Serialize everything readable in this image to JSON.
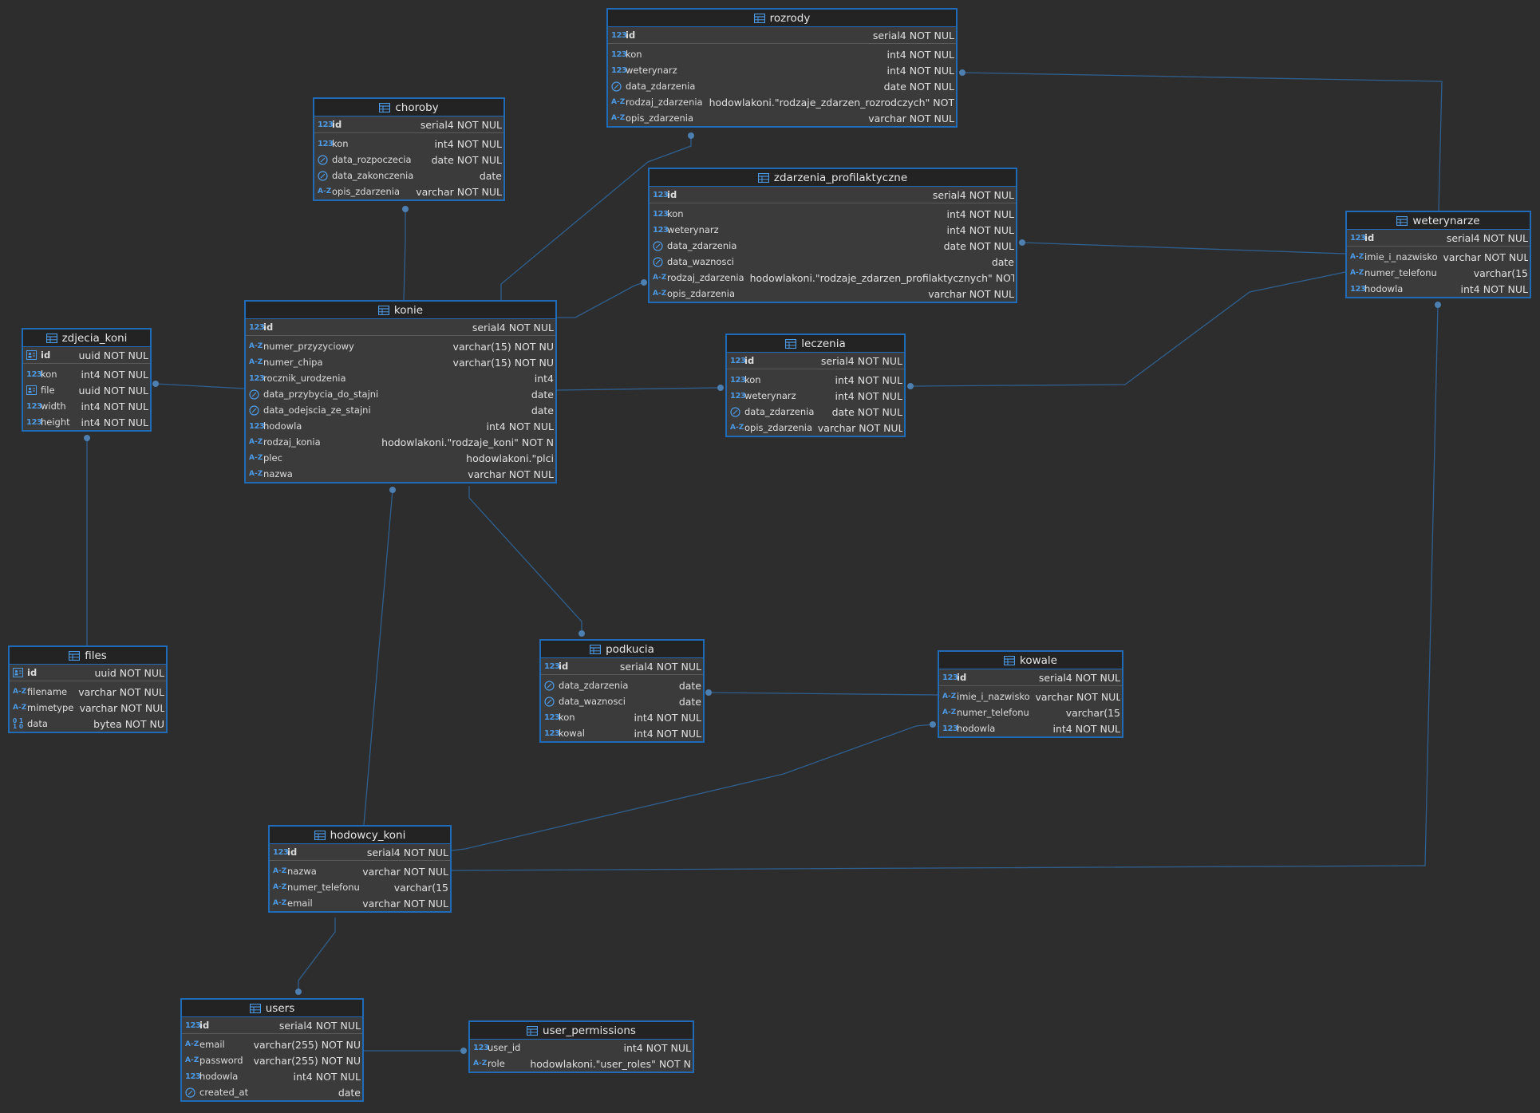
{
  "colors": {
    "background": "#2d2d2d",
    "table_border": "#1f6bb8",
    "header_bg": "#232323",
    "body_bg": "#3b3b3b",
    "edge": "#2f5f8f",
    "edge_dot": "#4d7fb0",
    "type_icon": "#4c9ae6"
  },
  "tables": [
    {
      "id": "rozrody",
      "name": "rozrody",
      "columns": [
        {
          "icon": "num",
          "name": "id",
          "type": "serial4 NOT NUL",
          "pk": true
        },
        {
          "icon": "num",
          "name": "kon",
          "type": "int4 NOT NUL"
        },
        {
          "icon": "num",
          "name": "weterynarz",
          "type": "int4 NOT NUL"
        },
        {
          "icon": "date",
          "name": "data_zdarzenia",
          "type": "date NOT NUL"
        },
        {
          "icon": "text",
          "name": "rodzaj_zdarzenia",
          "type": "hodowlakoni.\"rodzaje_zdarzen_rozrodczych\" NOT"
        },
        {
          "icon": "text",
          "name": "opis_zdarzenia",
          "type": "varchar NOT NUL"
        }
      ]
    },
    {
      "id": "choroby",
      "name": "choroby",
      "columns": [
        {
          "icon": "num",
          "name": "id",
          "type": "serial4 NOT NUL",
          "pk": true
        },
        {
          "icon": "num",
          "name": "kon",
          "type": "int4 NOT NUL"
        },
        {
          "icon": "date",
          "name": "data_rozpoczecia",
          "type": "date NOT NUL"
        },
        {
          "icon": "date",
          "name": "data_zakonczenia",
          "type": "date"
        },
        {
          "icon": "text",
          "name": "opis_zdarzenia",
          "type": "varchar NOT NUL"
        }
      ]
    },
    {
      "id": "zdarzenia_profilaktyczne",
      "name": "zdarzenia_profilaktyczne",
      "columns": [
        {
          "icon": "num",
          "name": "id",
          "type": "serial4 NOT NUL",
          "pk": true
        },
        {
          "icon": "num",
          "name": "kon",
          "type": "int4 NOT NUL"
        },
        {
          "icon": "num",
          "name": "weterynarz",
          "type": "int4 NOT NUL"
        },
        {
          "icon": "date",
          "name": "data_zdarzenia",
          "type": "date NOT NUL"
        },
        {
          "icon": "date",
          "name": "data_waznosci",
          "type": "date"
        },
        {
          "icon": "text",
          "name": "rodzaj_zdarzenia",
          "type": "hodowlakoni.\"rodzaje_zdarzen_profilaktycznych\" NOT"
        },
        {
          "icon": "text",
          "name": "opis_zdarzenia",
          "type": "varchar NOT NUL"
        }
      ]
    },
    {
      "id": "weterynarze",
      "name": "weterynarze",
      "columns": [
        {
          "icon": "num",
          "name": "id",
          "type": "serial4 NOT NUL",
          "pk": true
        },
        {
          "icon": "text",
          "name": "imie_i_nazwisko",
          "type": "varchar NOT NUL"
        },
        {
          "icon": "text",
          "name": "numer_telefonu",
          "type": "varchar(15"
        },
        {
          "icon": "num",
          "name": "hodowla",
          "type": "int4 NOT NUL"
        }
      ]
    },
    {
      "id": "zdjecia_koni",
      "name": "zdjecia_koni",
      "columns": [
        {
          "icon": "uuid",
          "name": "id",
          "type": "uuid NOT NUL",
          "pk": true
        },
        {
          "icon": "num",
          "name": "kon",
          "type": "int4 NOT NUL"
        },
        {
          "icon": "uuid",
          "name": "file",
          "type": "uuid NOT NUL"
        },
        {
          "icon": "num",
          "name": "width",
          "type": "int4 NOT NUL"
        },
        {
          "icon": "num",
          "name": "height",
          "type": "int4 NOT NUL"
        }
      ]
    },
    {
      "id": "konie",
      "name": "konie",
      "columns": [
        {
          "icon": "num",
          "name": "id",
          "type": "serial4 NOT NUL",
          "pk": true
        },
        {
          "icon": "text",
          "name": "numer_przyzyciowy",
          "type": "varchar(15) NOT NU"
        },
        {
          "icon": "text",
          "name": "numer_chipa",
          "type": "varchar(15) NOT NU"
        },
        {
          "icon": "num",
          "name": "rocznik_urodzenia",
          "type": "int4"
        },
        {
          "icon": "date",
          "name": "data_przybycia_do_stajni",
          "type": "date"
        },
        {
          "icon": "date",
          "name": "data_odejscia_ze_stajni",
          "type": "date"
        },
        {
          "icon": "num",
          "name": "hodowla",
          "type": "int4 NOT NUL"
        },
        {
          "icon": "text",
          "name": "rodzaj_konia",
          "type": "hodowlakoni.\"rodzaje_koni\" NOT N"
        },
        {
          "icon": "text",
          "name": "plec",
          "type": "hodowlakoni.\"plci"
        },
        {
          "icon": "text",
          "name": "nazwa",
          "type": "varchar NOT NUL"
        }
      ]
    },
    {
      "id": "leczenia",
      "name": "leczenia",
      "columns": [
        {
          "icon": "num",
          "name": "id",
          "type": "serial4 NOT NUL",
          "pk": true
        },
        {
          "icon": "num",
          "name": "kon",
          "type": "int4 NOT NUL"
        },
        {
          "icon": "num",
          "name": "weterynarz",
          "type": "int4 NOT NUL"
        },
        {
          "icon": "date",
          "name": "data_zdarzenia",
          "type": "date NOT NUL"
        },
        {
          "icon": "text",
          "name": "opis_zdarzenia",
          "type": "varchar NOT NUL"
        }
      ]
    },
    {
      "id": "files",
      "name": "files",
      "columns": [
        {
          "icon": "uuid",
          "name": "id",
          "type": "uuid NOT NUL",
          "pk": true
        },
        {
          "icon": "text",
          "name": "filename",
          "type": "varchar NOT NUL"
        },
        {
          "icon": "text",
          "name": "mimetype",
          "type": "varchar NOT NUL"
        },
        {
          "icon": "bin",
          "name": "data",
          "type": "bytea NOT NU"
        }
      ]
    },
    {
      "id": "podkucia",
      "name": "podkucia",
      "columns": [
        {
          "icon": "num",
          "name": "id",
          "type": "serial4 NOT NUL",
          "pk": true
        },
        {
          "icon": "date",
          "name": "data_zdarzenia",
          "type": "date"
        },
        {
          "icon": "date",
          "name": "data_waznosci",
          "type": "date"
        },
        {
          "icon": "num",
          "name": "kon",
          "type": "int4 NOT NUL"
        },
        {
          "icon": "num",
          "name": "kowal",
          "type": "int4 NOT NUL"
        }
      ]
    },
    {
      "id": "kowale",
      "name": "kowale",
      "columns": [
        {
          "icon": "num",
          "name": "id",
          "type": "serial4 NOT NUL",
          "pk": true
        },
        {
          "icon": "text",
          "name": "imie_i_nazwisko",
          "type": "varchar NOT NUL"
        },
        {
          "icon": "text",
          "name": "numer_telefonu",
          "type": "varchar(15"
        },
        {
          "icon": "num",
          "name": "hodowla",
          "type": "int4 NOT NUL"
        }
      ]
    },
    {
      "id": "hodowcy_koni",
      "name": "hodowcy_koni",
      "columns": [
        {
          "icon": "num",
          "name": "id",
          "type": "serial4 NOT NUL",
          "pk": true
        },
        {
          "icon": "text",
          "name": "nazwa",
          "type": "varchar NOT NUL"
        },
        {
          "icon": "text",
          "name": "numer_telefonu",
          "type": "varchar(15"
        },
        {
          "icon": "text",
          "name": "email",
          "type": "varchar NOT NUL"
        }
      ]
    },
    {
      "id": "users",
      "name": "users",
      "columns": [
        {
          "icon": "num",
          "name": "id",
          "type": "serial4 NOT NUL",
          "pk": true
        },
        {
          "icon": "text",
          "name": "email",
          "type": "varchar(255) NOT NU"
        },
        {
          "icon": "text",
          "name": "password",
          "type": "varchar(255) NOT NU"
        },
        {
          "icon": "num",
          "name": "hodowla",
          "type": "int4 NOT NUL"
        },
        {
          "icon": "date",
          "name": "created_at",
          "type": "date"
        }
      ]
    },
    {
      "id": "user_permissions",
      "name": "user_permissions",
      "columns": [
        {
          "icon": "num",
          "name": "user_id",
          "type": "int4 NOT NUL"
        },
        {
          "icon": "text",
          "name": "role",
          "type": "hodowlakoni.\"user_roles\" NOT N"
        }
      ]
    }
  ],
  "relationships": [
    {
      "from": "rozrody",
      "to": "konie"
    },
    {
      "from": "rozrody",
      "to": "weterynarze"
    },
    {
      "from": "choroby",
      "to": "konie"
    },
    {
      "from": "zdarzenia_profilaktyczne",
      "to": "konie"
    },
    {
      "from": "zdarzenia_profilaktyczne",
      "to": "weterynarze"
    },
    {
      "from": "zdjecia_koni",
      "to": "konie"
    },
    {
      "from": "zdjecia_koni",
      "to": "files"
    },
    {
      "from": "leczenia",
      "to": "konie"
    },
    {
      "from": "leczenia",
      "to": "weterynarze"
    },
    {
      "from": "podkucia",
      "to": "konie"
    },
    {
      "from": "podkucia",
      "to": "kowale"
    },
    {
      "from": "konie",
      "to": "hodowcy_koni"
    },
    {
      "from": "kowale",
      "to": "hodowcy_koni"
    },
    {
      "from": "weterynarze",
      "to": "hodowcy_koni"
    },
    {
      "from": "users",
      "to": "hodowcy_koni"
    },
    {
      "from": "user_permissions",
      "to": "users"
    }
  ]
}
